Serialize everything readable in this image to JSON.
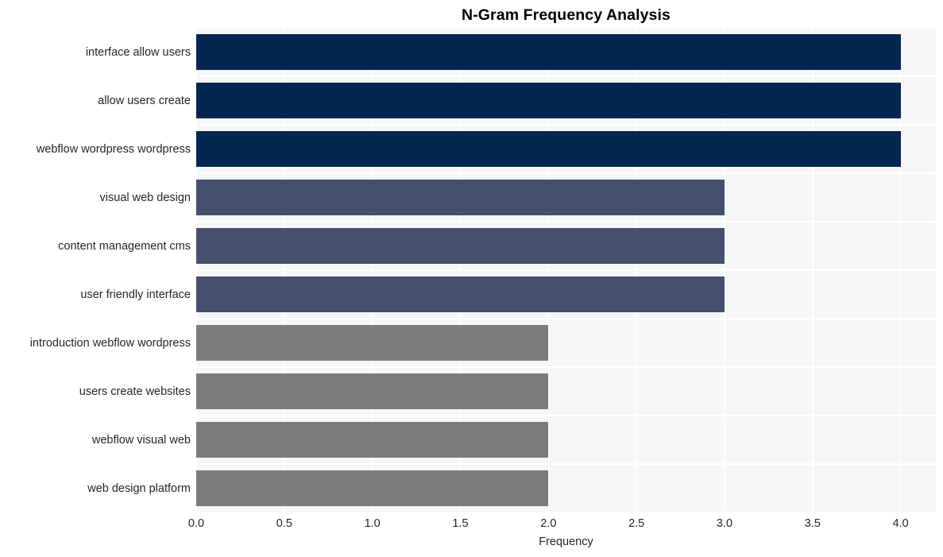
{
  "chart_data": {
    "type": "bar",
    "orientation": "horizontal",
    "title": "N-Gram Frequency Analysis",
    "xlabel": "Frequency",
    "ylabel": "",
    "categories": [
      "interface allow users",
      "allow users create",
      "webflow wordpress wordpress",
      "visual web design",
      "content management cms",
      "user friendly interface",
      "introduction webflow wordpress",
      "users create websites",
      "webflow visual web",
      "web design platform"
    ],
    "values": [
      4,
      4,
      4,
      3,
      3,
      3,
      2,
      2,
      2,
      2
    ],
    "bar_colors": [
      "#04254f",
      "#04254f",
      "#04254f",
      "#454f6e",
      "#454f6e",
      "#454f6e",
      "#7e7c7a",
      "#7e7c7a",
      "#7e7c7a",
      "#7e7c7a"
    ],
    "xlim": [
      0.0,
      4.2
    ],
    "xticks": [
      0.0,
      0.5,
      1.0,
      1.5,
      2.0,
      2.5,
      3.0,
      3.5,
      4.0
    ],
    "xtick_labels": [
      "0.0",
      "0.5",
      "1.0",
      "1.5",
      "2.0",
      "2.5",
      "3.0",
      "3.5",
      "4.0"
    ],
    "grid": true,
    "grid_color": "#ffffff",
    "plot_background": "#f6f6f6",
    "figure_background": "#ffffff",
    "legend": null,
    "legend_position": "none"
  }
}
